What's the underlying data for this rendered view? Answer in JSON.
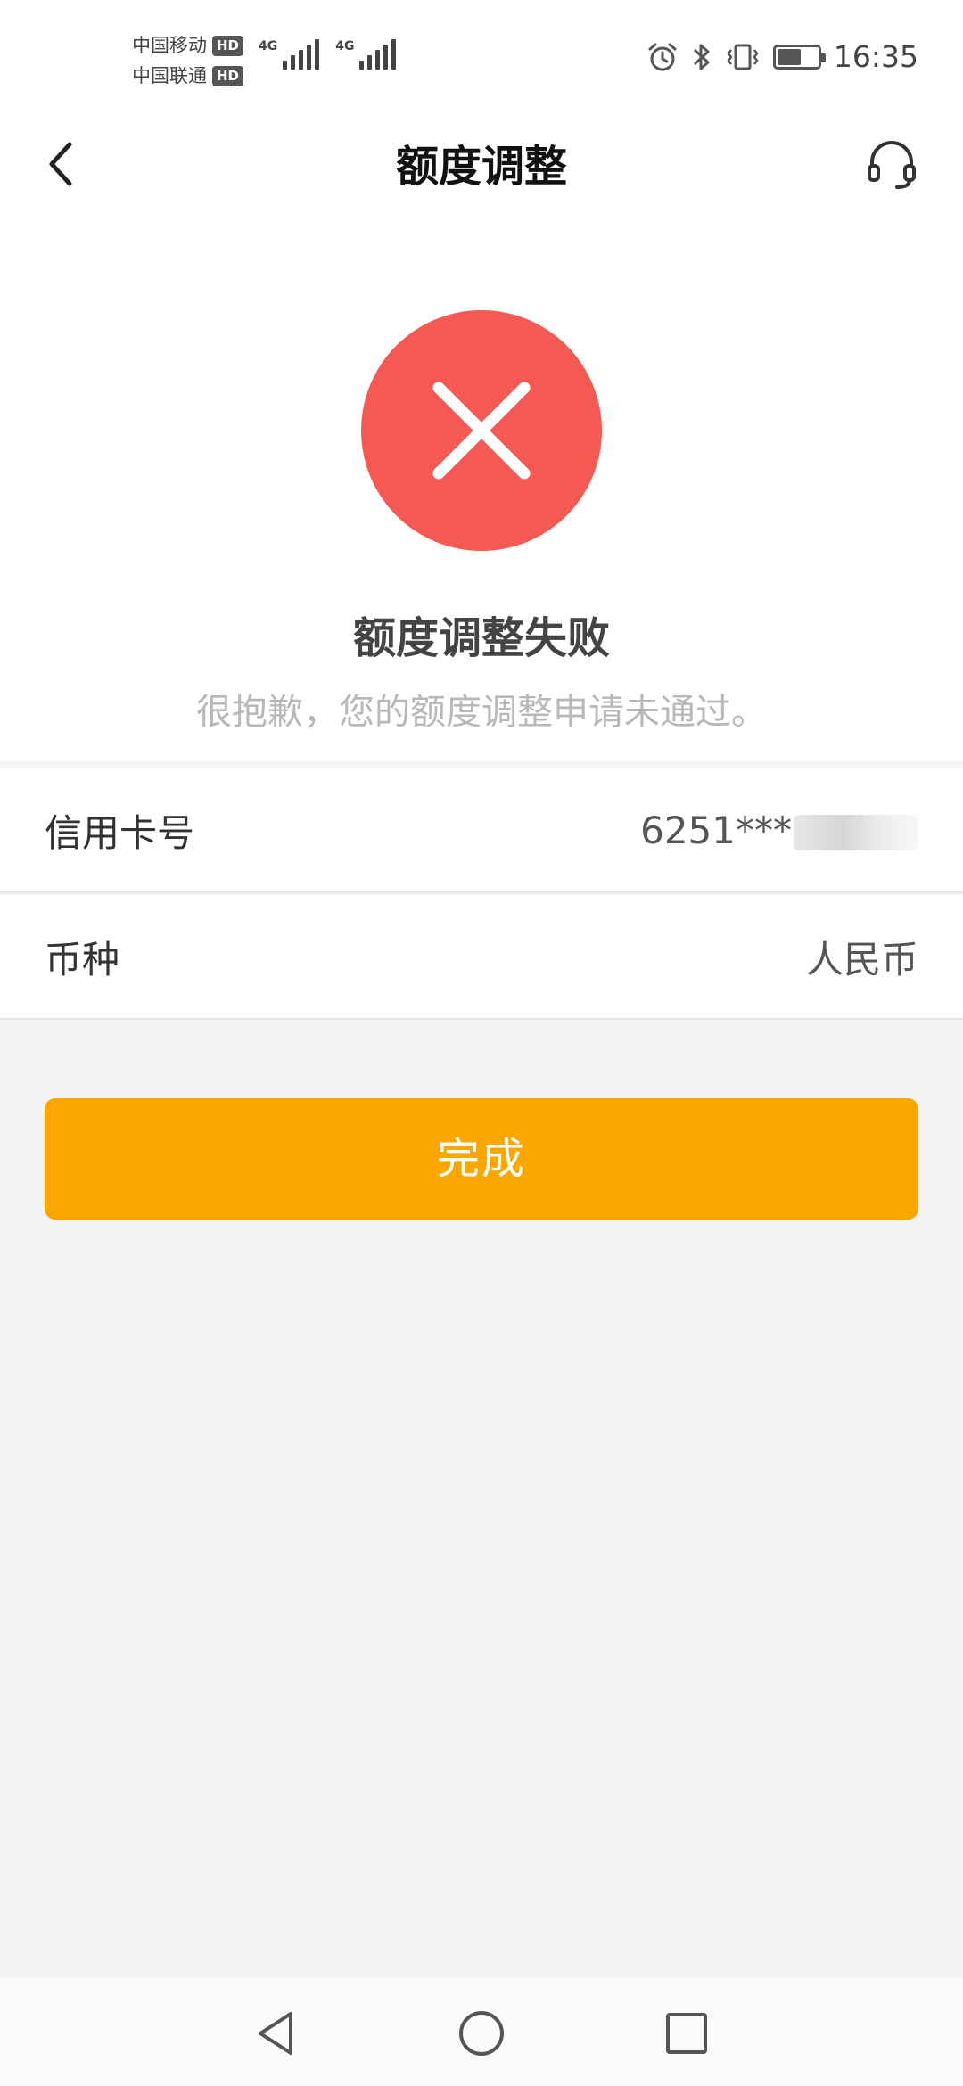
{
  "status_bar": {
    "carrier_1": "中国移动",
    "carrier_2": "中国联通",
    "hd_1": "HD",
    "hd_2": "HD",
    "network_1": "4G",
    "network_2": "4G",
    "time": "16:35",
    "battery_level": 0.62
  },
  "nav": {
    "title": "额度调整"
  },
  "result": {
    "title": "额度调整失败",
    "description": "很抱歉，您的额度调整申请未通过。",
    "status_color": "#f45a53"
  },
  "info": {
    "card_label": "信用卡号",
    "card_value": "6251***",
    "currency_label": "币种",
    "currency_value": "人民币"
  },
  "actions": {
    "done_label": "完成",
    "accent_color": "#fca600"
  },
  "icons": {
    "back": "chevron-left-icon",
    "service": "headset-icon",
    "fail": "close-icon",
    "sys_back": "triangle-back-icon",
    "sys_home": "circle-home-icon",
    "sys_recent": "square-recent-icon"
  }
}
